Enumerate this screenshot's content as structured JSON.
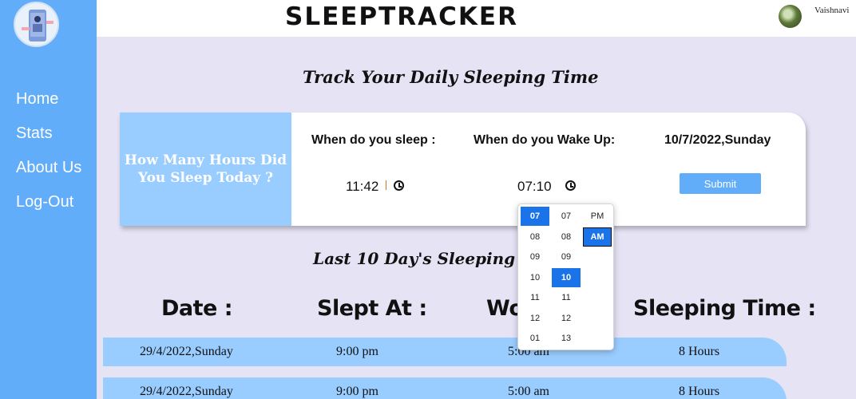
{
  "app": {
    "title": "SLEEPTRACKER",
    "user": "Vaishnavi"
  },
  "sidebar": {
    "items": [
      {
        "label": "Home"
      },
      {
        "label": "Stats"
      },
      {
        "label": "About Us"
      },
      {
        "label": "Log-Out"
      }
    ]
  },
  "main": {
    "heading": "Track Your Daily Sleeping Time",
    "card": {
      "prompt": "How Many Hours Did You Sleep Today ?",
      "sleep_label": "When do you sleep :",
      "wake_label": "When do you Wake Up:",
      "date": "10/7/2022,Sunday",
      "sleep_time": "11:42",
      "wake_time": "07:10",
      "submit_label": "Submit"
    },
    "history_heading": "Last 10 Day's Sleeping Tim",
    "table": {
      "headers": [
        "Date :",
        "Slept At :",
        "Wo",
        "Sleeping Time :"
      ],
      "rows": [
        [
          "29/4/2022,Sunday",
          "9:00 pm",
          "5:00 am",
          "8 Hours"
        ],
        [
          "29/4/2022,Sunday",
          "9:00 pm",
          "5:00 am",
          "8 Hours"
        ]
      ]
    }
  },
  "picker": {
    "hours": [
      "07",
      "08",
      "09",
      "10",
      "11",
      "12",
      "01"
    ],
    "minutes": [
      "07",
      "08",
      "09",
      "10",
      "11",
      "12",
      "13"
    ],
    "ampm": [
      "PM",
      "AM"
    ],
    "selected_hour": "07",
    "selected_minute": "10",
    "selected_ampm": "AM"
  },
  "colors": {
    "sidebar": "#61adfa",
    "accent": "#99ccff",
    "page_bg": "#e6e3f5",
    "picker_select": "#1a73e8"
  }
}
